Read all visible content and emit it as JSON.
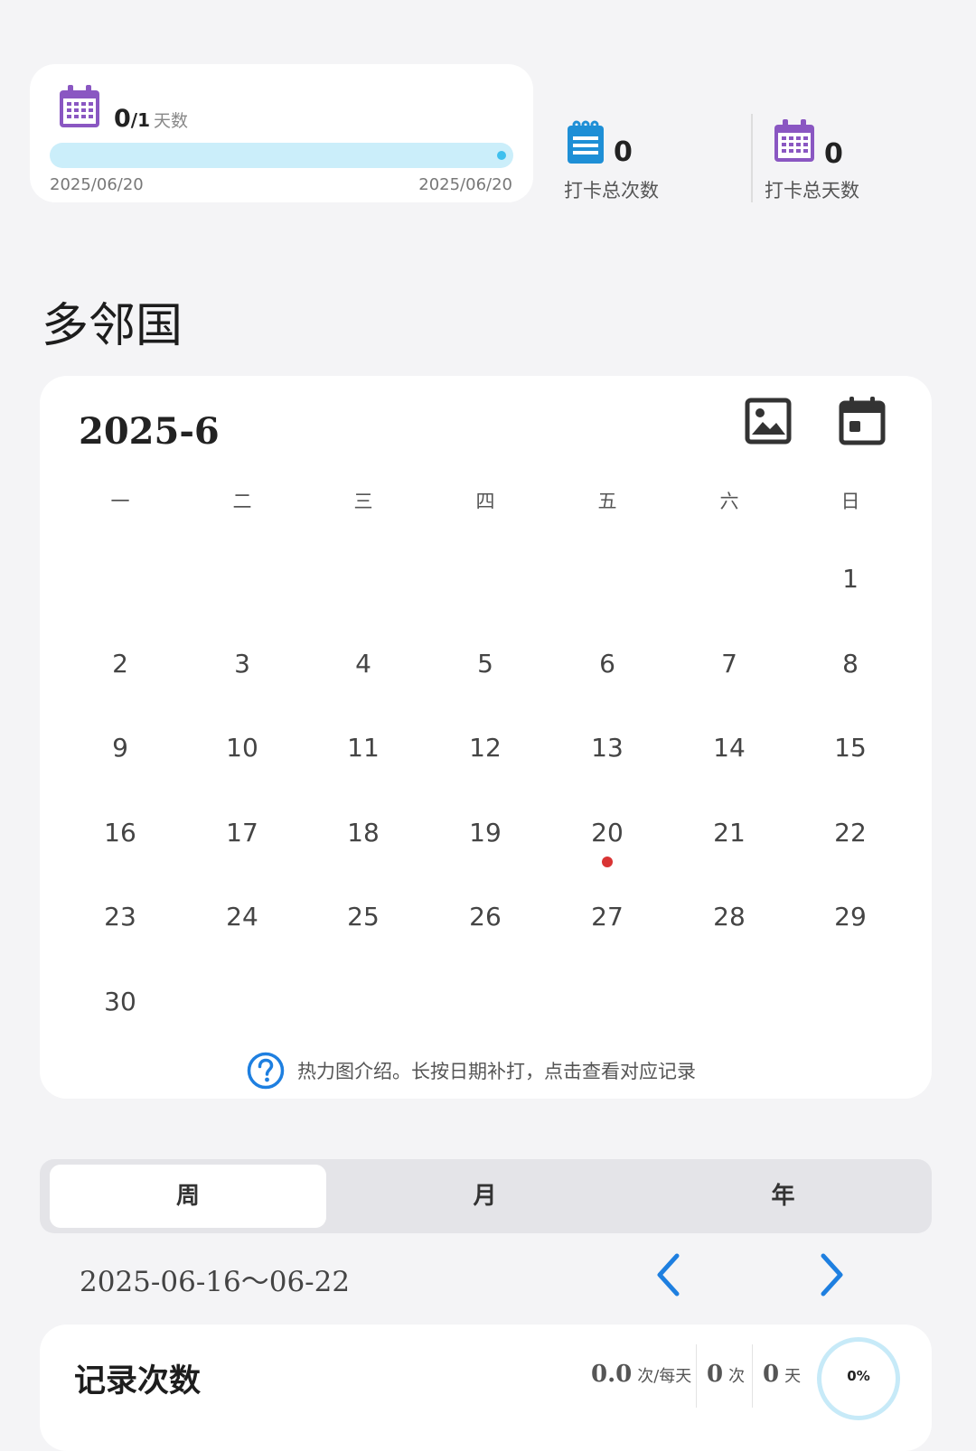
{
  "progress": {
    "current": "0",
    "total": "/1",
    "unit": "天数",
    "start_date": "2025/06/20",
    "end_date": "2025/06/20",
    "fill_fraction": 0
  },
  "stats": [
    {
      "value": "0",
      "label": "打卡总次数",
      "icon": "checklist-icon",
      "color": "#1e8fd6"
    },
    {
      "value": "0",
      "label": "打卡总天数",
      "icon": "calendar-icon",
      "color": "#8a57c2"
    }
  ],
  "habit_title": "多邻国",
  "calendar": {
    "month_label": "2025-6",
    "weekdays": [
      "一",
      "二",
      "三",
      "四",
      "五",
      "六",
      "日"
    ],
    "weeks": [
      [
        "",
        "",
        "",
        "",
        "",
        "",
        "1"
      ],
      [
        "2",
        "3",
        "4",
        "5",
        "6",
        "7",
        "8"
      ],
      [
        "9",
        "10",
        "11",
        "12",
        "13",
        "14",
        "15"
      ],
      [
        "16",
        "17",
        "18",
        "19",
        "20",
        "21",
        "22"
      ],
      [
        "23",
        "24",
        "25",
        "26",
        "27",
        "28",
        "29"
      ],
      [
        "30",
        "",
        "",
        "",
        "",
        "",
        ""
      ]
    ],
    "marked_day": "20",
    "mark_color": "#d93434",
    "hint": "热力图介绍。长按日期补打，点击查看对应记录"
  },
  "period_tabs": [
    {
      "label": "周",
      "active": true
    },
    {
      "label": "月",
      "active": false
    },
    {
      "label": "年",
      "active": false
    }
  ],
  "week_range": "2025-06-16～06-22",
  "record": {
    "title": "记录次数",
    "per_day_value": "0.0",
    "per_day_unit": "次/每天",
    "count_value": "0",
    "count_unit": "次",
    "days_value": "0",
    "days_unit": "天",
    "ring_percent": "0%"
  },
  "colors": {
    "accent_blue": "#1e7fe0",
    "purple": "#8a57c2",
    "bar_track": "#cbeefa",
    "bar_dot": "#3fc0ee"
  }
}
